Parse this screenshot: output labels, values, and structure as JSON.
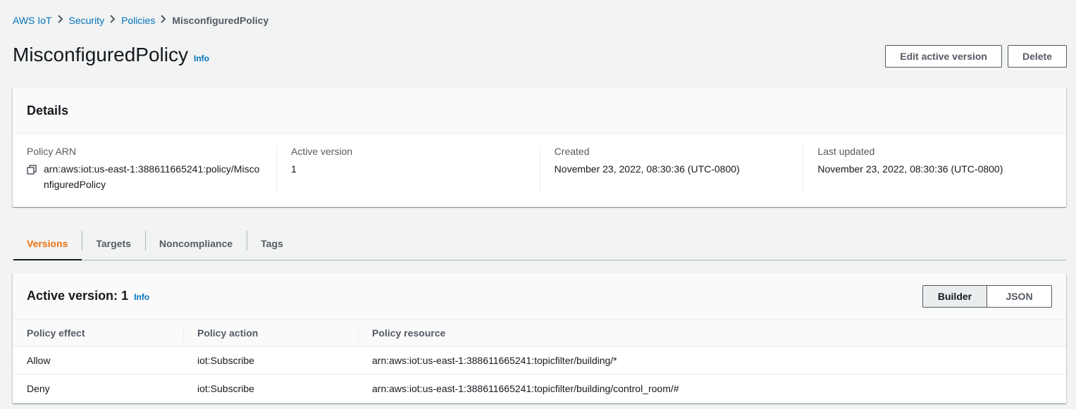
{
  "breadcrumb": {
    "items": [
      "AWS IoT",
      "Security",
      "Policies"
    ],
    "current": "MisconfiguredPolicy"
  },
  "header": {
    "title": "MisconfiguredPolicy",
    "info": "Info",
    "edit_label": "Edit active version",
    "delete_label": "Delete"
  },
  "details": {
    "title": "Details",
    "arn_label": "Policy ARN",
    "arn_value": "arn:aws:iot:us-east-1:388611665241:policy/MisconfiguredPolicy",
    "active_version_label": "Active version",
    "active_version_value": "1",
    "created_label": "Created",
    "created_value": "November 23, 2022, 08:30:36 (UTC-0800)",
    "updated_label": "Last updated",
    "updated_value": "November 23, 2022, 08:30:36 (UTC-0800)"
  },
  "tabs": [
    "Versions",
    "Targets",
    "Noncompliance",
    "Tags"
  ],
  "versions": {
    "title": "Active version: 1",
    "info": "Info",
    "builder_label": "Builder",
    "json_label": "JSON",
    "columns": [
      "Policy effect",
      "Policy action",
      "Policy resource"
    ],
    "rows": [
      [
        "Allow",
        "iot:Subscribe",
        "arn:aws:iot:us-east-1:388611665241:topicfilter/building/*"
      ],
      [
        "Deny",
        "iot:Subscribe",
        "arn:aws:iot:us-east-1:388611665241:topicfilter/building/control_room/#"
      ]
    ]
  },
  "colors": {
    "link": "#0073bb",
    "active_tab": "#ec7211",
    "text": "#16191f",
    "muted": "#545b64",
    "background": "#f2f3f3"
  },
  "icons": {
    "copy": "copy-icon",
    "separator": "chevron-right-icon"
  }
}
